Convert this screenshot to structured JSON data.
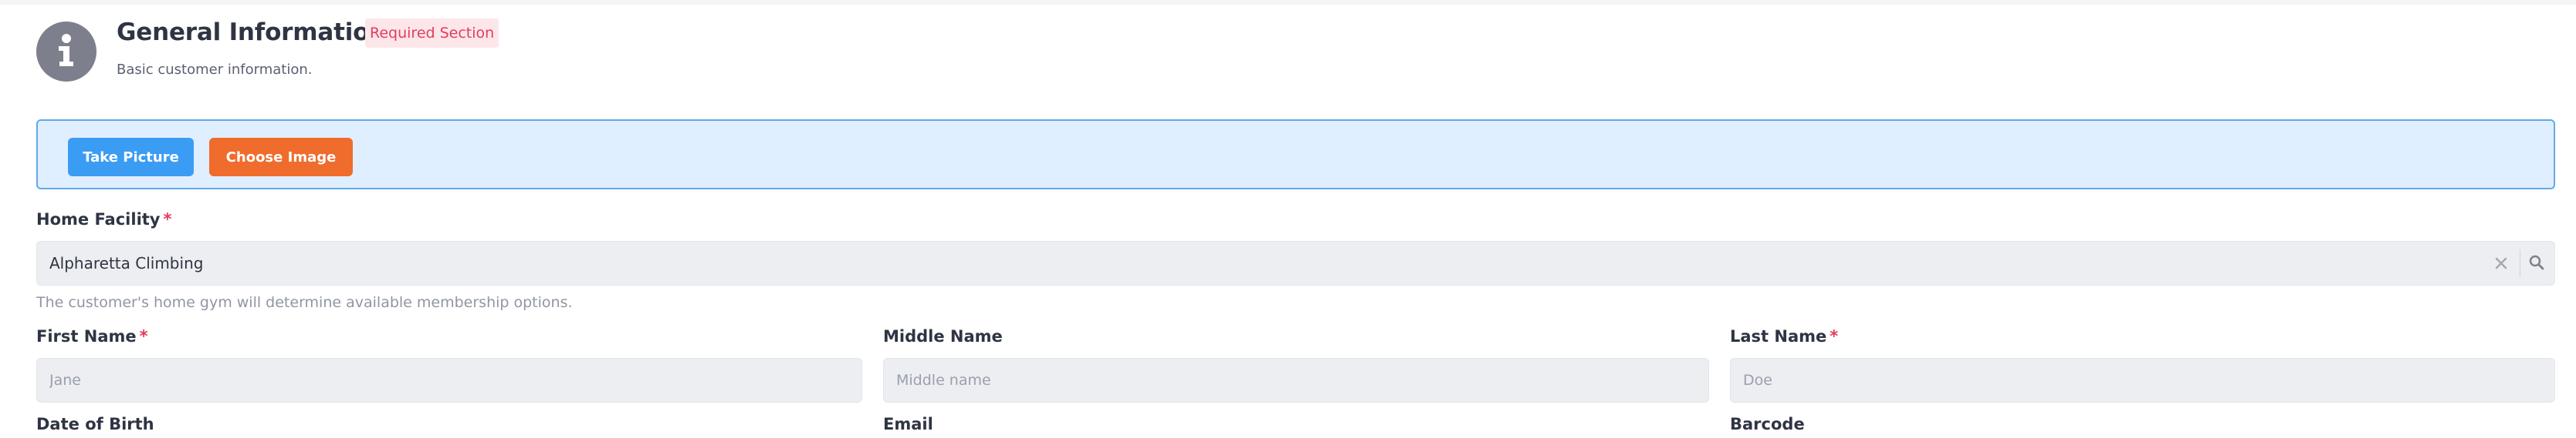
{
  "header": {
    "icon": "info-icon",
    "title": "General Information",
    "badge": "Required Section",
    "description": "Basic customer information."
  },
  "photo": {
    "take_picture_label": "Take Picture",
    "choose_image_label": "Choose Image"
  },
  "home_facility": {
    "label": "Home Facility",
    "required_marker": "*",
    "value": "Alpharetta Climbing",
    "help_text": "The customer's home gym will determine available membership options.",
    "clear_icon": "close-icon",
    "search_icon": "search-icon"
  },
  "first_name": {
    "label": "First Name",
    "required_marker": "*",
    "placeholder": "Jane"
  },
  "middle_name": {
    "label": "Middle Name",
    "placeholder": "Middle name"
  },
  "last_name": {
    "label": "Last Name",
    "required_marker": "*",
    "placeholder": "Doe"
  },
  "date_of_birth": {
    "label": "Date of Birth"
  },
  "email": {
    "label": "Email"
  },
  "barcode": {
    "label": "Barcode"
  },
  "colors": {
    "accent_blue": "#3b9cf3",
    "accent_orange": "#ef6c2c",
    "required_red": "#e23d5a",
    "panel_bg": "#dfefff"
  }
}
